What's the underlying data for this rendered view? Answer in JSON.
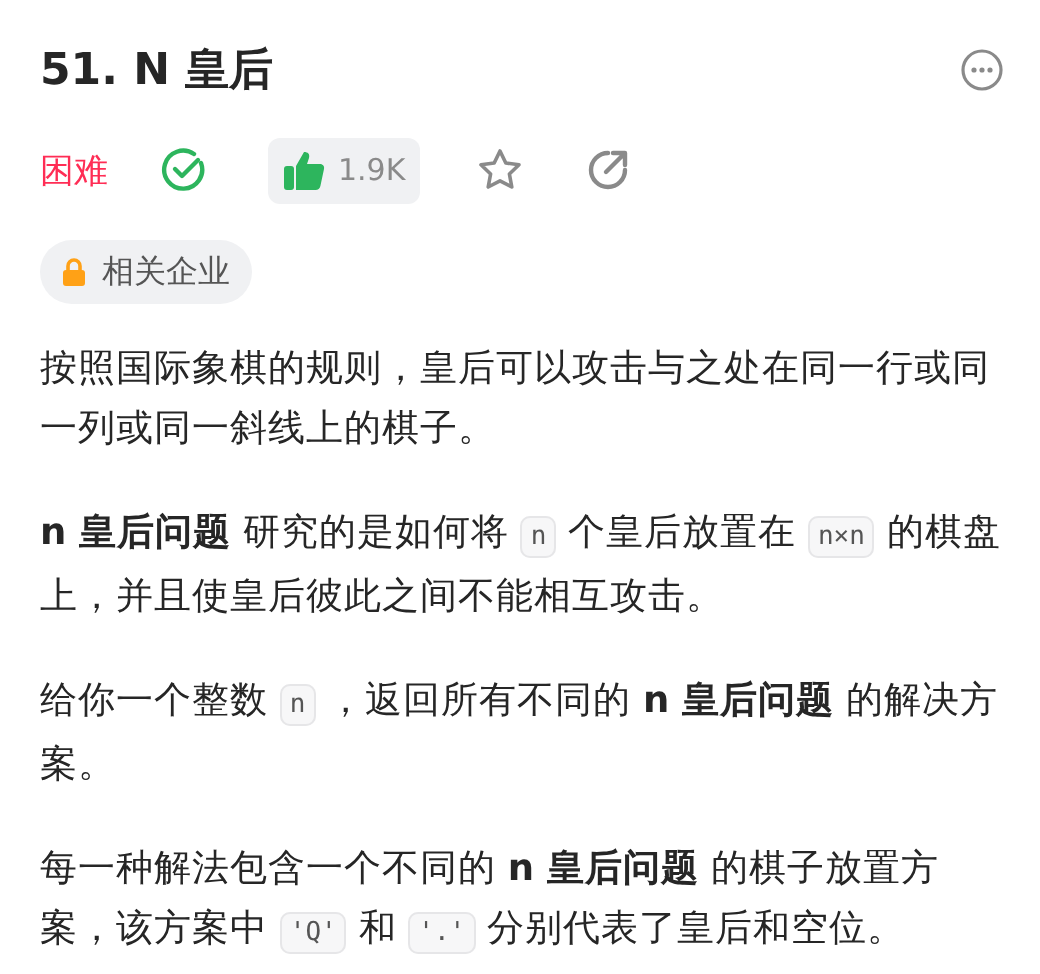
{
  "title": "51. N 皇后",
  "meta": {
    "difficulty": {
      "label": "困难",
      "kind": "hard"
    },
    "solved": true,
    "liked": true,
    "likes": "1.9K",
    "starred": false
  },
  "company_tag": {
    "label": "相关企业",
    "locked": true
  },
  "paragraphs": [
    [
      {
        "kind": "text",
        "text": "按照国际象棋的规则，皇后可以攻击与之处在同一行或同一列或同一斜线上的棋子。"
      }
    ],
    [
      {
        "kind": "text",
        "text": "**n 皇后问题** 研究的是如何将 "
      },
      {
        "kind": "code",
        "text": "n"
      },
      {
        "kind": "text",
        "text": " 个皇后放置在 "
      },
      {
        "kind": "code",
        "text": "n×n"
      },
      {
        "kind": "text",
        "text": " 的棋盘上，并且使皇后彼此之间不能相互攻击。"
      }
    ],
    [
      {
        "kind": "text",
        "text": "给你一个整数 "
      },
      {
        "kind": "code",
        "text": "n"
      },
      {
        "kind": "text",
        "text": " ，返回所有不同的 **n 皇后问题** 的解决方案。"
      }
    ],
    [
      {
        "kind": "text",
        "text": "每一种解法包含一个不同的 **n 皇后问题** 的棋子放置方案，该方案中 "
      },
      {
        "kind": "code",
        "text": "'Q'"
      },
      {
        "kind": "text",
        "text": " 和 "
      },
      {
        "kind": "code",
        "text": "'.'"
      },
      {
        "kind": "text",
        "text": " 分别代表了皇后和空位。"
      }
    ]
  ]
}
